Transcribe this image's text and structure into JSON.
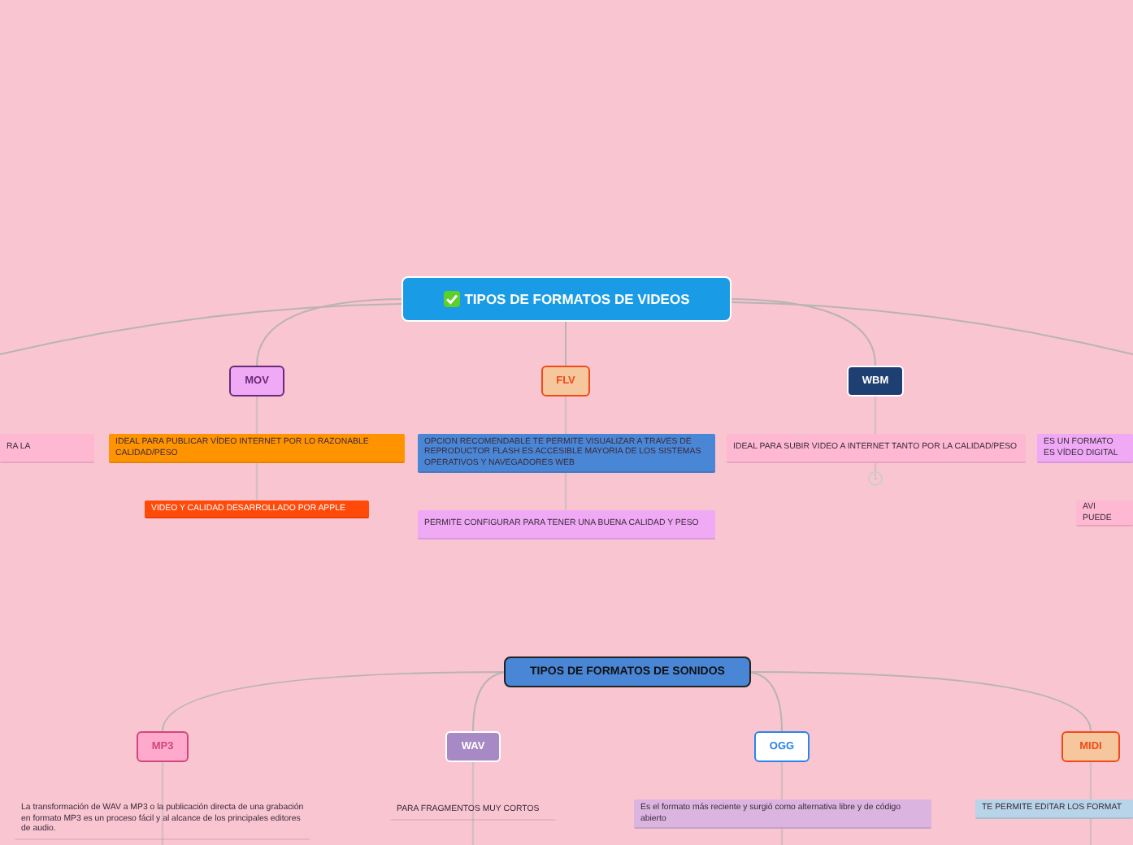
{
  "video_map": {
    "title": "TIPOS DE FORMATOS DE VIDEOS",
    "branches": [
      {
        "notes": [
          {
            "text": "RA LA",
            "color": "#ffb8d2"
          }
        ]
      },
      {
        "label": "MOV",
        "color": "#f0aaf5",
        "notes": [
          {
            "text": "IDEAL PARA PUBLICAR VÍDEO INTERNET  POR LO RAZONABLE CALIDAD/PESO",
            "color": "#ff9300"
          },
          {
            "text": "VIDEO Y CALIDAD DESARROLLADO POR APPLE",
            "color": "#ff4a0a"
          }
        ]
      },
      {
        "label": "FLV",
        "color": "#f6c79d",
        "notes": [
          {
            "text": "OPCION RECOMENDABLE TE PERMITE VISUALIZAR A TRAVES DE  REPRODUCTOR FLASH ES ACCESIBLE MAYORIA DE LOS SISTEMAS OPERATIVOS Y NAVEGADORES WEB",
            "color": "#4a86d6"
          },
          {
            "text": "PERMITE CONFIGURAR PARA TENER UNA BUENA CALIDAD Y PESO",
            "color": "#f0aaf5"
          }
        ]
      },
      {
        "label": "WBM",
        "color": "#1e3f72",
        "hidden_count": "1",
        "notes": [
          {
            "text": "IDEAL PARA SUBIR VIDEO A INTERNET TANTO POR LA CALIDAD/PESO",
            "color": "#ffb8d2"
          }
        ]
      },
      {
        "notes": [
          {
            "text": "ES UN FORMATO ES VÍDEO DIGITAL",
            "color": "#f0aaf5"
          },
          {
            "text": "AVI PUEDE",
            "color": "#ffb8d2"
          }
        ]
      }
    ]
  },
  "sound_map": {
    "title": "TIPOS DE FORMATOS DE SONIDOS",
    "branches": [
      {
        "label": "MP3",
        "color": "#ffaacc",
        "notes": [
          {
            "text": "La transformación de WAV a MP3 o la publicación directa de una grabación en formato MP3 es un proceso fácil y al alcance de los principales editores de audio."
          }
        ]
      },
      {
        "label": "WAV",
        "color": "#a689c5",
        "notes": [
          {
            "text": "PARA FRAGMENTOS MUY CORTOS"
          }
        ]
      },
      {
        "label": "OGG",
        "color": "#ffffff",
        "notes": [
          {
            "text": "Es el formato más reciente y surgió como alternativa libre y de código abierto",
            "color": "#dbb5e0"
          }
        ]
      },
      {
        "label": "MIDI",
        "color": "#f6c79d",
        "notes": [
          {
            "text": "TE PERMITE EDITAR LOS FORMAT",
            "color": "#b8d4e8"
          }
        ]
      }
    ]
  }
}
